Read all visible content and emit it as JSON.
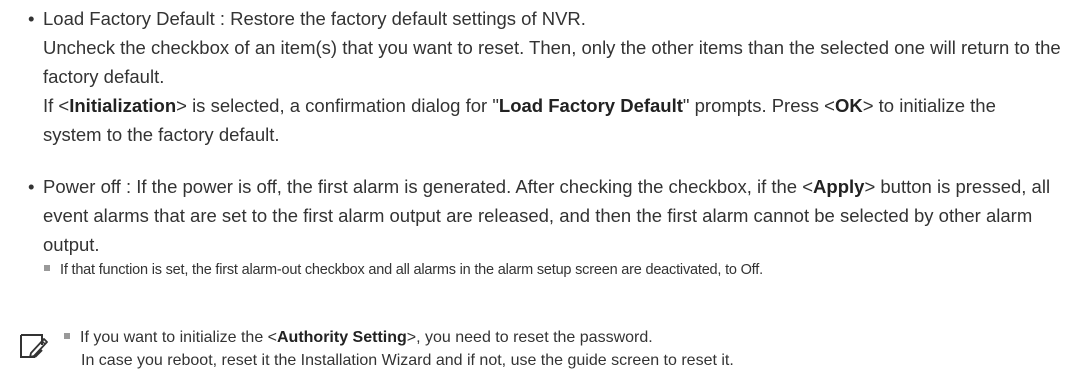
{
  "bullet_symbol": "•",
  "item1": {
    "line1": "Load Factory Default : Restore the factory default settings of NVR.",
    "line2": "Uncheck the checkbox of an item(s) that you want to reset. Then, only the other items than the selected one will return to the factory default.",
    "line3_a": "If <",
    "line3_b": "Initialization",
    "line3_c": "> is selected, a confirmation dialog for \"",
    "line3_d": "Load Factory Default",
    "line3_e": "\" prompts. Press <",
    "line3_f": "OK",
    "line3_g": "> to initialize the system to the factory default."
  },
  "item2": {
    "part_a": "Power off : If the power is off, the first alarm is generated. After checking the checkbox, if the <",
    "part_b": "Apply",
    "part_c": "> button is pressed, all event alarms that are set to the first alarm output are released, and then the first alarm cannot be selected by other alarm output."
  },
  "subnote": "If that function is set, the first alarm-out checkbox and all alarms in the alarm setup screen are deactivated, to Off.",
  "memo": {
    "icon": "note-pencil-icon",
    "line1_a": "If you want to initialize the <",
    "line1_b": "Authority Setting",
    "line1_c": ">, you need to reset the password.",
    "line2": "In case you reboot, reset it the Installation Wizard and if not, use the guide screen to reset it."
  }
}
